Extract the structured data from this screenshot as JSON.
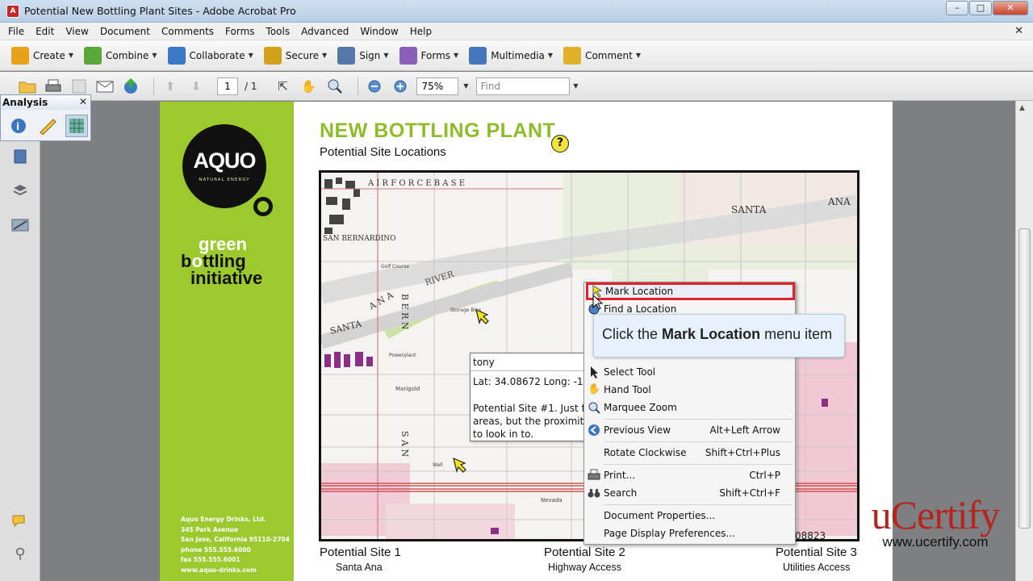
{
  "window": {
    "title": "Potential New Bottling Plant Sites - Adobe Acrobat Pro",
    "app_icon": "acrobat-icon",
    "minimize": "–",
    "maximize": "□",
    "close": "✕"
  },
  "menubar": {
    "items": [
      "File",
      "Edit",
      "View",
      "Document",
      "Comments",
      "Forms",
      "Tools",
      "Advanced",
      "Window",
      "Help"
    ],
    "doc_close": "✕"
  },
  "tasks": [
    {
      "label": "Create",
      "icon": "create-pdf-icon",
      "color": "#e8a21a"
    },
    {
      "label": "Combine",
      "icon": "combine-files-icon",
      "color": "#5aa83a"
    },
    {
      "label": "Collaborate",
      "icon": "collaborate-icon",
      "color": "#3c78c8"
    },
    {
      "label": "Secure",
      "icon": "lock-icon",
      "color": "#d4a21a"
    },
    {
      "label": "Sign",
      "icon": "pen-icon",
      "color": "#5577aa"
    },
    {
      "label": "Forms",
      "icon": "forms-icon",
      "color": "#8a5fb8"
    },
    {
      "label": "Multimedia",
      "icon": "multimedia-icon",
      "color": "#4477bb"
    },
    {
      "label": "Comment",
      "icon": "comment-icon",
      "color": "#e0b22a"
    }
  ],
  "navbar": {
    "page_current": "1",
    "page_total": "/ 1",
    "zoom": "75%",
    "find_placeholder": "Find"
  },
  "analysis": {
    "title": "Analysis",
    "close": "✕"
  },
  "page": {
    "logo_brand": "AQUO",
    "logo_sub": "NATURAL ENERGY",
    "tagline_1": "green",
    "tagline_2a": "b",
    "tagline_2b": "o",
    "tagline_2c": "ttling",
    "tagline_3": "initiative",
    "company_lines": [
      "Aquo Energy Drinks, Ltd.",
      "345 Park Avenue",
      "San Jose, California 95110-2704",
      "phone 555.555.6000",
      "fax 555.555.6001",
      "www.aquo-drinks.com"
    ],
    "title": "NEW BOTTLING PLANT",
    "subtitle": "Potential Site Locations",
    "help": "?",
    "sites": [
      {
        "label": "Potential Site 1",
        "sub": "Santa Ana"
      },
      {
        "label": "Potential Site 2",
        "sub": "Highway Access"
      },
      {
        "label": "Potential Site 3",
        "sub": "Utilities Access"
      }
    ],
    "map_labels": [
      "A I R   F O R C E   B A S E",
      "SAN BERNARDINO",
      "SANTA",
      "ANA",
      "RIVER",
      "SANTA",
      "A N A",
      "S A N",
      "B E R N",
      "Golf Course",
      "Storage Bins",
      "Powerplant",
      "Marigold",
      "Well",
      "Nevada",
      "SAN",
      "BERN"
    ]
  },
  "note": {
    "author": "tony",
    "coords": "Lat: 34.08672 Long: -11",
    "body_1": "Potential Site #1. Just fa",
    "body_2": "areas, but the proximity",
    "body_3": "to look in to."
  },
  "context_menu": {
    "items": [
      {
        "label": "Mark Location",
        "shortcut": "",
        "icon": "mark-location-icon",
        "highlighted": true
      },
      {
        "label": "Find a Location",
        "shortcut": "",
        "icon": "find-location-icon"
      },
      {
        "label": "Select Tool",
        "shortcut": "",
        "icon": "select-arrow-icon"
      },
      {
        "label": "Hand Tool",
        "shortcut": "",
        "icon": "hand-icon"
      },
      {
        "label": "Marquee Zoom",
        "shortcut": "",
        "icon": "marquee-zoom-icon"
      },
      {
        "label": "Previous View",
        "shortcut": "Alt+Left Arrow",
        "icon": "previous-view-icon"
      },
      {
        "label": "Rotate Clockwise",
        "shortcut": "Shift+Ctrl+Plus",
        "icon": ""
      },
      {
        "label": "Print...",
        "shortcut": "Ctrl+P",
        "icon": "print-icon"
      },
      {
        "label": "Search",
        "shortcut": "Shift+Ctrl+F",
        "icon": "binoculars-icon"
      },
      {
        "label": "Document Properties...",
        "shortcut": "",
        "icon": ""
      },
      {
        "label": "Page Display Preferences...",
        "shortcut": "",
        "icon": ""
      }
    ],
    "peek_text": "08823"
  },
  "callout": {
    "prefix": "Click the",
    "bold": "Mark Location",
    "suffix": "menu item"
  },
  "watermark": {
    "brand": "uCertify",
    "url": "www.ucertify.com"
  }
}
